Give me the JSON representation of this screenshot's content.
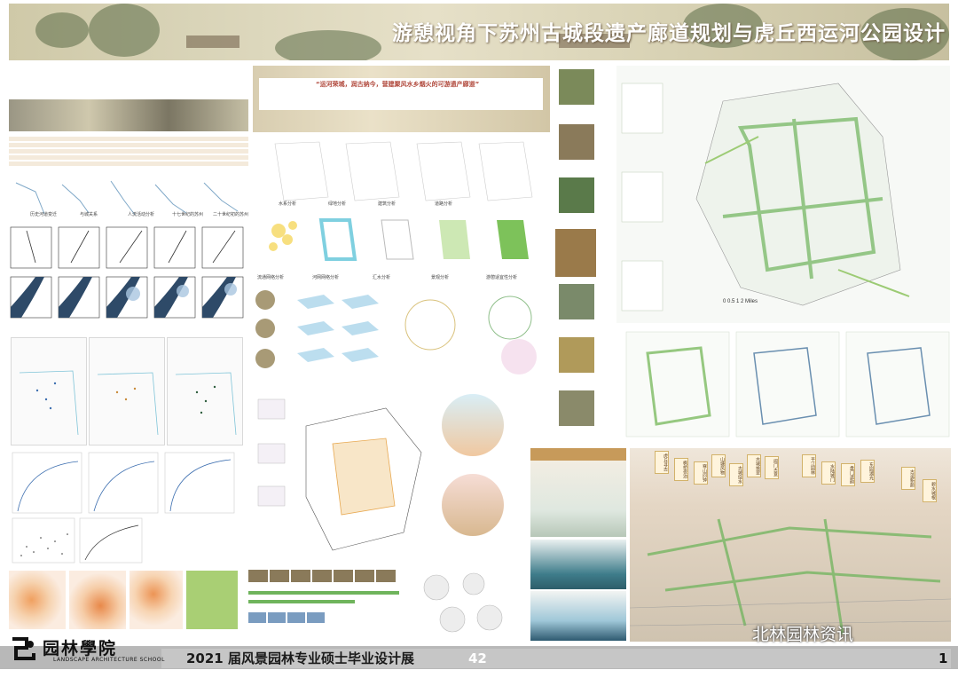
{
  "header": {
    "title": "游憩视角下苏州古城段遗产廊道规划与虎丘西运河公园设计"
  },
  "intro": {
    "slogan": "“运河荣城，润古纳今，营建聚风水乡烟火的可游遗产廊道”"
  },
  "analysis_labels": {
    "row1": [
      "水系分析",
      "绿地分析",
      "建筑分析",
      "道路分析"
    ],
    "row2": [
      "流通网络分析",
      "河网网络分析",
      "汇水分析",
      "景观分析",
      "游憩适宜性分析"
    ],
    "left_maps": [
      "历史河道变迁",
      "与城关系",
      "人流活动分析",
      "十七世纪的苏州",
      "二十世纪初的苏州"
    ]
  },
  "masterplan": {
    "scale_label": "0  0.5  1        2 Miles"
  },
  "bird_view_labels": [
    "虎丘寻古",
    "枫桥夜泊",
    "寒山问钟",
    "山塘风物",
    "古城绕水",
    "古城拾翠",
    "阊门古意",
    "平江园林",
    "水陆城门",
    "盘门遗韵",
    "东园湖光",
    "古运新颜",
    "碧水城根"
  ],
  "footer": {
    "logo_text": "园林學院",
    "logo_sub": "LANDSCAPE ARCHITECTURE SCHOOL",
    "title": "2021 届风景园林专业硕士毕业设计展",
    "number": "42",
    "page": "1",
    "watermark": "北林园林资讯"
  },
  "colors": {
    "green": "#6fb45c",
    "footer_gray": "#b8b8b8",
    "accent_red": "#b0473a"
  }
}
